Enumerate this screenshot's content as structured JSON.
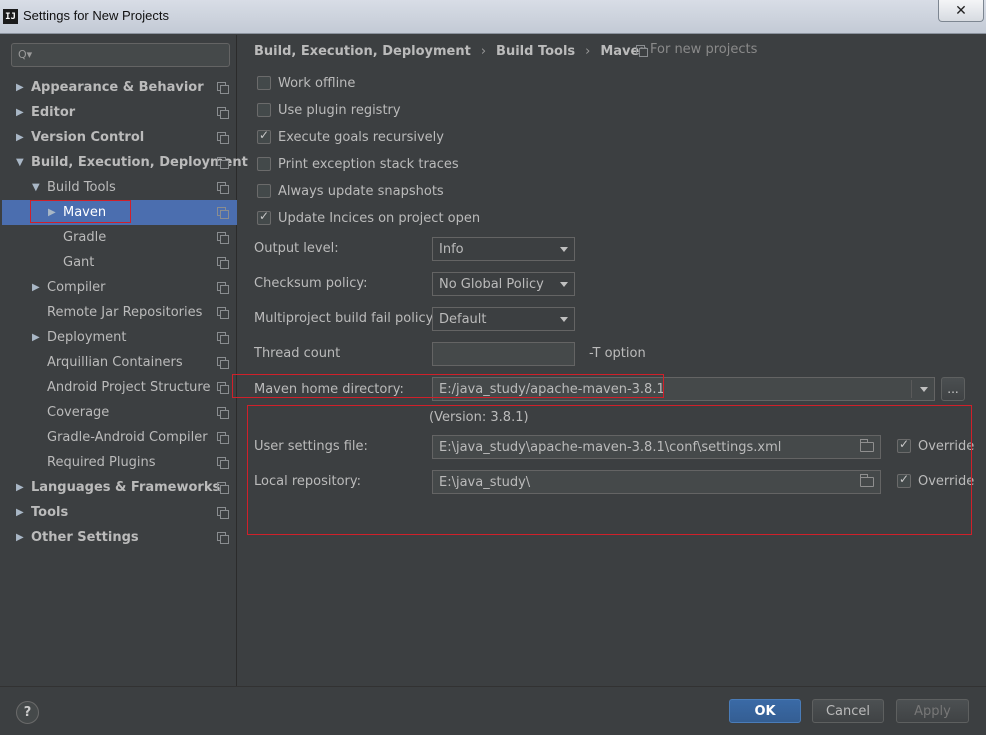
{
  "window": {
    "title": "Settings for New Projects",
    "icon_text": "IJ",
    "close_label": "✕"
  },
  "search": {
    "placeholder": "",
    "icon": "Q▾"
  },
  "sidebar": {
    "items": [
      {
        "label": "Appearance & Behavior"
      },
      {
        "label": "Editor"
      },
      {
        "label": "Version Control"
      },
      {
        "label": "Build, Execution, Deployment"
      },
      {
        "label": "Build Tools"
      },
      {
        "label": "Maven"
      },
      {
        "label": "Gradle"
      },
      {
        "label": "Gant"
      },
      {
        "label": "Compiler"
      },
      {
        "label": "Remote Jar Repositories"
      },
      {
        "label": "Deployment"
      },
      {
        "label": "Arquillian Containers"
      },
      {
        "label": "Android Project Structure"
      },
      {
        "label": "Coverage"
      },
      {
        "label": "Gradle-Android Compiler"
      },
      {
        "label": "Required Plugins"
      },
      {
        "label": "Languages & Frameworks"
      },
      {
        "label": "Tools"
      },
      {
        "label": "Other Settings"
      }
    ]
  },
  "breadcrumb": {
    "items": [
      "Build, Execution, Deployment",
      "Build Tools",
      "Maven"
    ],
    "separator": "›",
    "scope": "For new projects"
  },
  "options": {
    "work_offline": "Work offline",
    "use_plugin_registry": "Use plugin registry",
    "execute_goals_recursively": "Execute goals recursively",
    "print_exception_stack_traces": "Print exception stack traces",
    "always_update_snapshots": "Always update snapshots",
    "update_indices": "Update Incices on project open"
  },
  "form": {
    "output_level_label": "Output level:",
    "output_level_value": "Info",
    "checksum_label": "Checksum policy:",
    "checksum_value": "No Global Policy",
    "multiproject_label": "Multiproject build fail policy:",
    "multiproject_value": "Default",
    "thread_count_label": "Thread count",
    "thread_count_value": "",
    "thread_count_hint": "-T option",
    "maven_home_label": "Maven home directory:",
    "maven_home_value": "E:/java_study/apache-maven-3.8.1",
    "ellipsis_label": "...",
    "version_text": "(Version: 3.8.1)",
    "user_settings_label": "User settings file:",
    "user_settings_value": "E:\\java_study\\apache-maven-3.8.1\\conf\\settings.xml",
    "local_repo_label": "Local repository:",
    "local_repo_value": "E:\\java_study\\",
    "override_label": "Override"
  },
  "footer": {
    "help": "?",
    "ok": "OK",
    "cancel": "Cancel",
    "apply": "Apply"
  },
  "colors": {
    "background": "#3c3f41",
    "selection": "#4b6eaf",
    "highlight_box": "#d0202a",
    "primary_button": "#365f95"
  }
}
